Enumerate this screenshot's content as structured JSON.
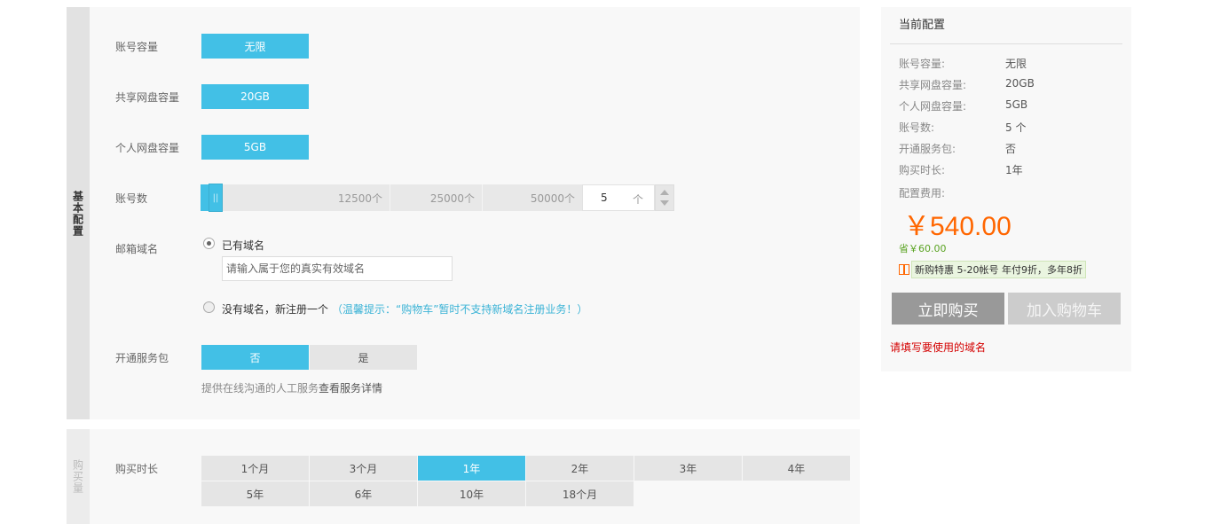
{
  "basic": {
    "side_label": "基本配置",
    "capacity_label": "账号容量",
    "capacity_value": "无限",
    "shared_label": "共享网盘容量",
    "shared_value": "20GB",
    "personal_label": "个人网盘容量",
    "personal_value": "5GB",
    "accounts_label": "账号数",
    "slider": {
      "marks": [
        "12500个",
        "25000个",
        "50000个"
      ],
      "handle_glyph": "||",
      "value": "5",
      "unit": "个"
    },
    "domain_label": "邮箱域名",
    "domain_have": "已有域名",
    "domain_placeholder": "请输入属于您的真实有效域名",
    "domain_none": "没有域名，新注册一个",
    "domain_tip": "（温馨提示：“购物车”暂时不支持新域名注册业务！）",
    "service_label": "开通服务包",
    "service_no": "否",
    "service_yes": "是",
    "service_desc": "提供在线沟通的人工服务",
    "service_link": "查看服务详情"
  },
  "purchase": {
    "side_label": "购买量",
    "duration_label": "购买时长",
    "durations": [
      "1个月",
      "3个月",
      "1年",
      "2年",
      "3年",
      "4年",
      "5年",
      "6年",
      "10年",
      "18个月"
    ],
    "selected": "1年"
  },
  "summary": {
    "title": "当前配置",
    "rows": [
      {
        "k": "账号容量:",
        "v": "无限"
      },
      {
        "k": "共享网盘容量:",
        "v": "20GB"
      },
      {
        "k": "个人网盘容量:",
        "v": "5GB"
      },
      {
        "k": "账号数:",
        "v": "5 个"
      },
      {
        "k": "开通服务包:",
        "v": "否"
      },
      {
        "k": "购买时长:",
        "v": "1年"
      }
    ],
    "fee_label": "配置费用:",
    "price": "￥540.00",
    "save": "省￥60.00",
    "promo": "新购特惠 5-20帐号 年付9折，多年8折",
    "buy_button": "立即购买",
    "cart_button": "加入购物车",
    "error": "请填写要使用的域名"
  },
  "colors": {
    "accent": "#42c0e6",
    "price": "#ff6600",
    "error": "#d40000"
  }
}
